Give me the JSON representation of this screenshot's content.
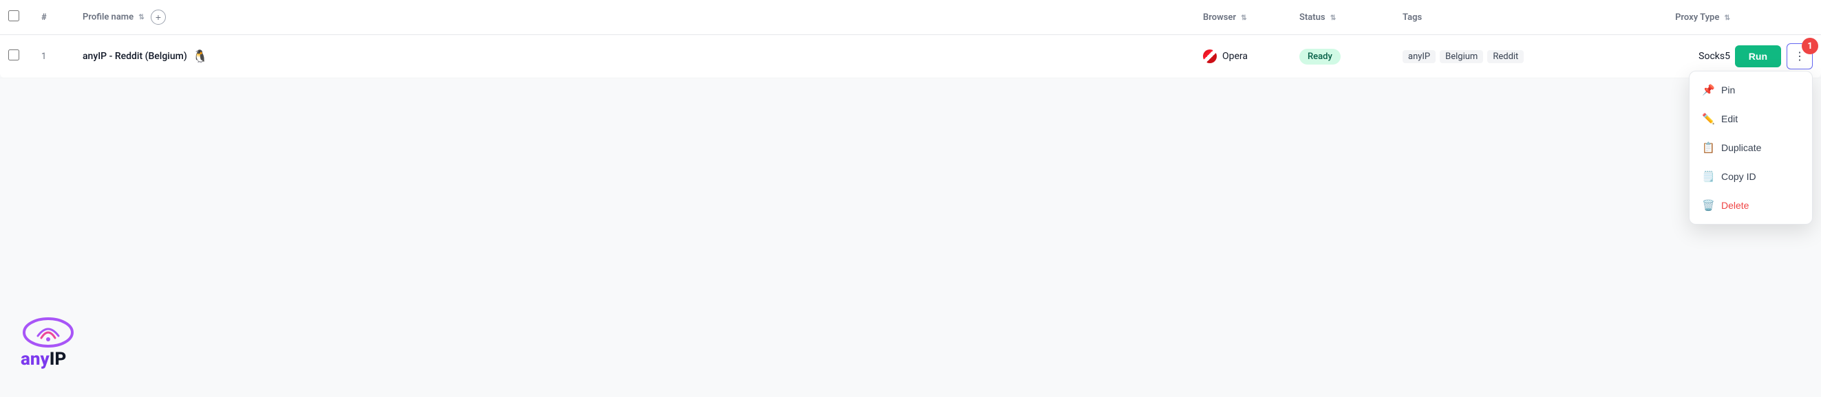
{
  "table": {
    "columns": [
      {
        "key": "checkbox",
        "label": ""
      },
      {
        "key": "num",
        "label": "#"
      },
      {
        "key": "profile_name",
        "label": "Profile name",
        "sortable": true
      },
      {
        "key": "browser",
        "label": "Browser",
        "sortable": true
      },
      {
        "key": "status",
        "label": "Status",
        "sortable": true
      },
      {
        "key": "tags",
        "label": "Tags"
      },
      {
        "key": "proxy_type",
        "label": "Proxy Type",
        "sortable": true
      },
      {
        "key": "actions",
        "label": ""
      }
    ],
    "rows": [
      {
        "id": 1,
        "num": "1",
        "profile_name": "anyIP - Reddit (Belgium)",
        "browser": "Opera",
        "status": "Ready",
        "tags": [
          "anyIP",
          "Belgium",
          "Reddit"
        ],
        "proxy_type": "Socks5"
      }
    ]
  },
  "buttons": {
    "run_label": "Run",
    "add_label": "+"
  },
  "context_menu": {
    "items": [
      {
        "label": "Pin",
        "icon": "📌",
        "action": "pin"
      },
      {
        "label": "Edit",
        "icon": "✏️",
        "action": "edit"
      },
      {
        "label": "Duplicate",
        "icon": "📋",
        "action": "duplicate"
      },
      {
        "label": "Copy ID",
        "icon": "🗒️",
        "action": "copy-id"
      },
      {
        "label": "Delete",
        "icon": "🗑️",
        "action": "delete"
      }
    ]
  },
  "notification_count": "1",
  "logo": {
    "text_prefix": "any",
    "text_suffix": "IP"
  }
}
